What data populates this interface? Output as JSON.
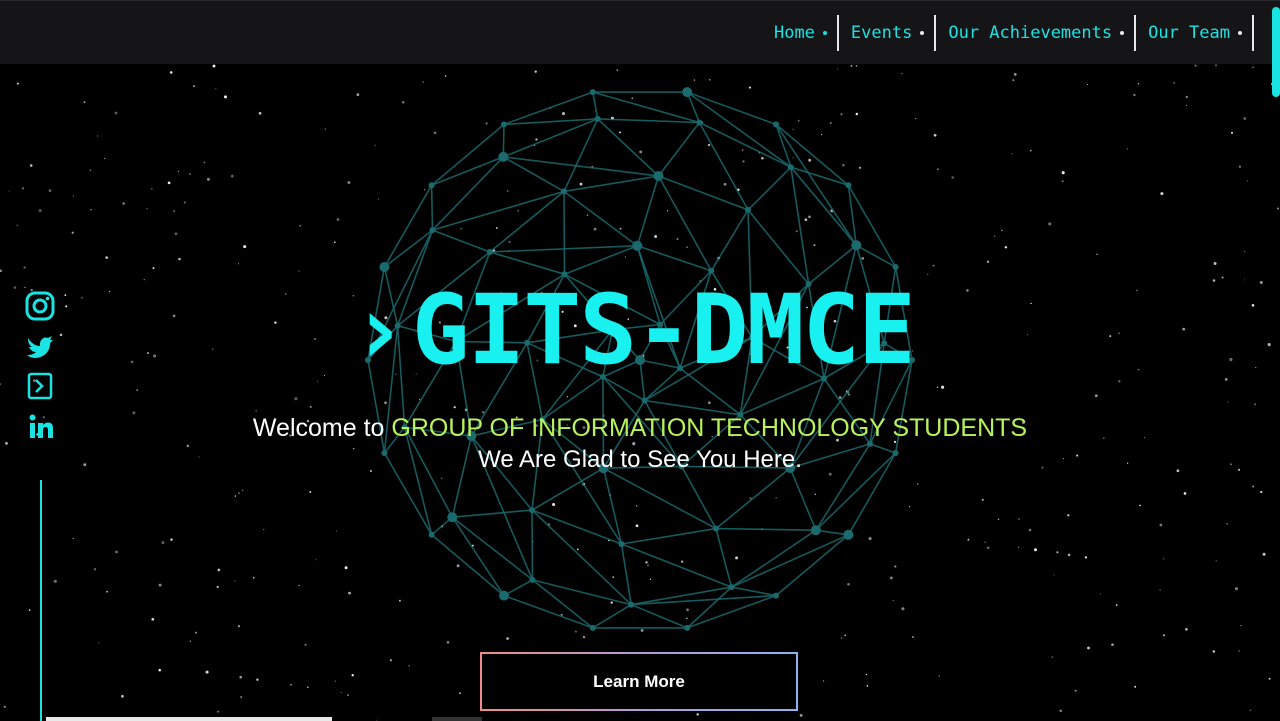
{
  "nav": {
    "items": [
      {
        "label": "Home",
        "active": true
      },
      {
        "label": "Events",
        "active": false
      },
      {
        "label": "Our Achievements",
        "active": false
      },
      {
        "label": "Our Team",
        "active": false
      }
    ]
  },
  "social": {
    "icons": [
      "instagram-icon",
      "twitter-icon",
      "terminal-icon",
      "linkedin-icon"
    ]
  },
  "hero": {
    "chevron": "›",
    "title": "GITS-DMCE",
    "welcome_prefix": "Welcome to ",
    "welcome_accent": "GROUP OF INFORMATION TECHNOLOGY STUDENTS",
    "tagline": "We Are Glad to See You Here.",
    "button_label": "Learn More"
  },
  "colors": {
    "accent": "#19e3e3",
    "highlight": "#b9f35a",
    "background": "#000000",
    "navbar": "#151518"
  }
}
